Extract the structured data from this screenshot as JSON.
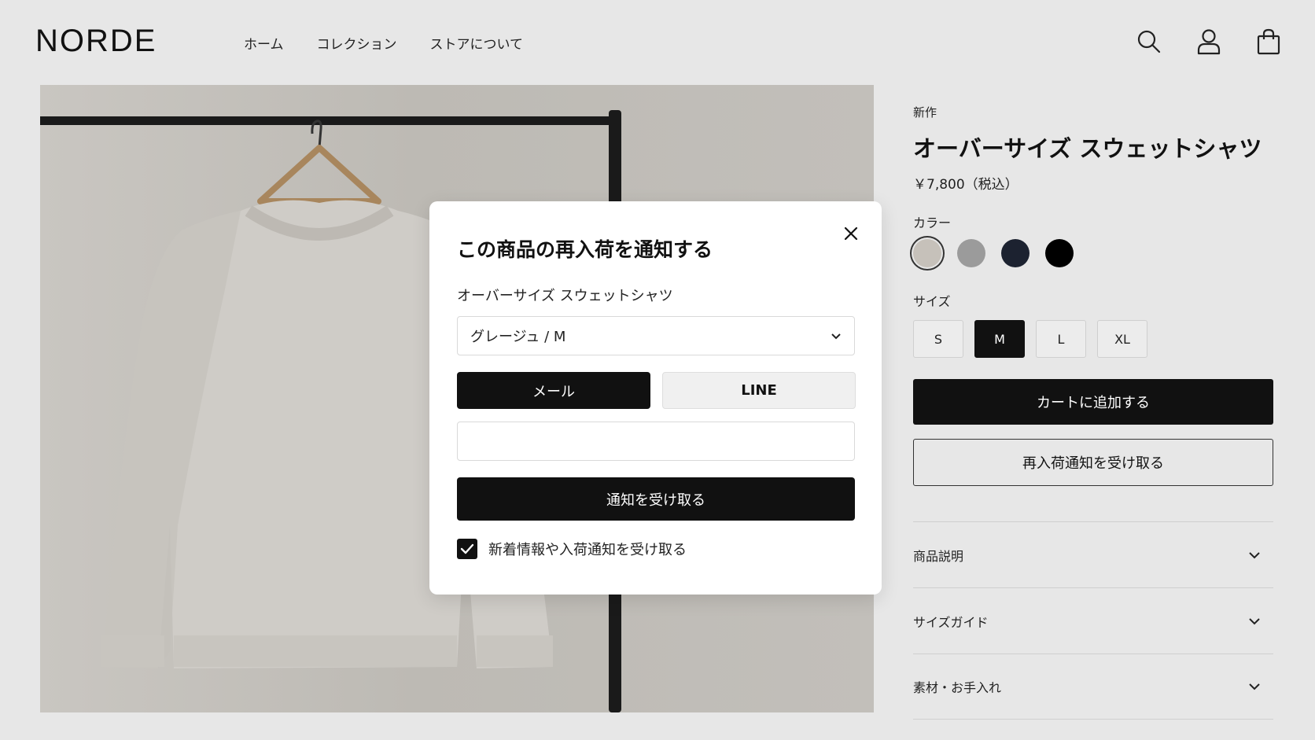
{
  "header": {
    "logo": "NORDE",
    "nav": [
      "ホーム",
      "コレクション",
      "ストアについて"
    ],
    "icons": [
      "search-icon",
      "user-icon",
      "bag-icon"
    ]
  },
  "product": {
    "badge": "新作",
    "title": "オーバーサイズ スウェットシャツ",
    "price": "￥7,800（税込）",
    "color_label": "カラー",
    "colors": [
      {
        "name": "greige",
        "hex": "#c6c1ba",
        "selected": true
      },
      {
        "name": "gray",
        "hex": "#9b9b9b",
        "selected": false
      },
      {
        "name": "navy",
        "hex": "#1c2230",
        "selected": false
      },
      {
        "name": "black",
        "hex": "#000000",
        "selected": false
      }
    ],
    "size_label": "サイズ",
    "sizes": [
      "S",
      "M",
      "L",
      "XL"
    ],
    "selected_size": "M",
    "add_to_cart": "カートに追加する",
    "restock_button": "再入荷通知を受け取る",
    "accordion": [
      "商品説明",
      "サイズガイド",
      "素材・お手入れ"
    ]
  },
  "modal": {
    "title": "この商品の再入荷を通知する",
    "product_name": "オーバーサイズ スウェットシャツ",
    "variant": "グレージュ / M",
    "channels": [
      "メール",
      "LINE"
    ],
    "active_channel": "メール",
    "input_value": "",
    "input_placeholder": "",
    "submit": "通知を受け取る",
    "optin_label": "新着情報や入荷通知を受け取る",
    "optin_checked": true
  },
  "colors": {
    "primary": "#111111",
    "background": "#e7e7e7"
  }
}
